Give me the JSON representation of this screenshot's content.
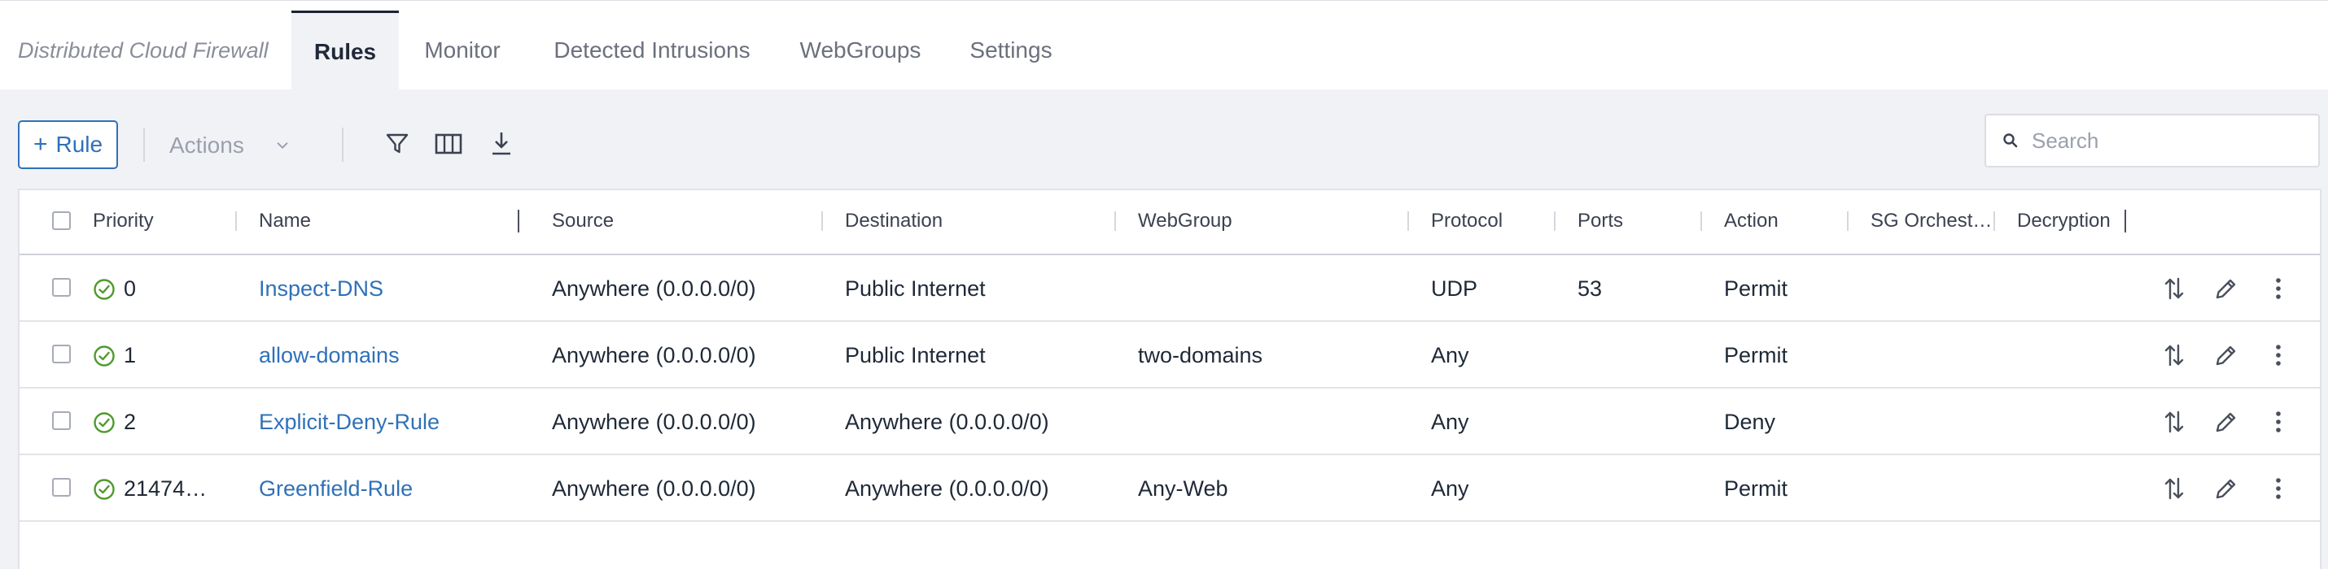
{
  "header": {
    "brand": "Distributed Cloud Firewall",
    "tabs": [
      {
        "label": "Rules",
        "active": true
      },
      {
        "label": "Monitor",
        "active": false
      },
      {
        "label": "Detected Intrusions",
        "active": false
      },
      {
        "label": "WebGroups",
        "active": false
      },
      {
        "label": "Settings",
        "active": false
      }
    ]
  },
  "toolbar": {
    "add_rule_label": "Rule",
    "add_rule_icon": "plus-icon",
    "actions_label": "Actions",
    "icons": [
      "filter-icon",
      "columns-icon",
      "download-icon"
    ],
    "search_placeholder": "Search",
    "search_value": ""
  },
  "table": {
    "columns": [
      "Priority",
      "Name",
      "Source",
      "Destination",
      "WebGroup",
      "Protocol",
      "Ports",
      "Action",
      "SG Orchest…",
      "Decryption"
    ],
    "rows": [
      {
        "priority": "0",
        "name": "Inspect-DNS",
        "source": "Anywhere (0.0.0.0/0)",
        "destination": "Public Internet",
        "webgroup": "",
        "protocol": "UDP",
        "ports": "53",
        "action": "Permit",
        "sg": "",
        "decryption": ""
      },
      {
        "priority": "1",
        "name": "allow-domains",
        "source": "Anywhere (0.0.0.0/0)",
        "destination": "Public Internet",
        "webgroup": "two-domains",
        "protocol": "Any",
        "ports": "",
        "action": "Permit",
        "sg": "",
        "decryption": ""
      },
      {
        "priority": "2",
        "name": "Explicit-Deny-Rule",
        "source": "Anywhere (0.0.0.0/0)",
        "destination": "Anywhere (0.0.0.0/0)",
        "webgroup": "",
        "protocol": "Any",
        "ports": "",
        "action": "Deny",
        "sg": "",
        "decryption": ""
      },
      {
        "priority": "21474…",
        "name": "Greenfield-Rule",
        "source": "Anywhere (0.0.0.0/0)",
        "destination": "Anywhere (0.0.0.0/0)",
        "webgroup": "Any-Web",
        "protocol": "Any",
        "ports": "",
        "action": "Permit",
        "sg": "",
        "decryption": ""
      }
    ],
    "row_status_icon": "check-circle-icon",
    "row_action_icons": [
      "reorder-icon",
      "edit-icon",
      "more-vertical-icon"
    ]
  },
  "colors": {
    "accent": "#2f71b8",
    "status_ok": "#4f9a2c",
    "background": "#f1f2f6"
  }
}
